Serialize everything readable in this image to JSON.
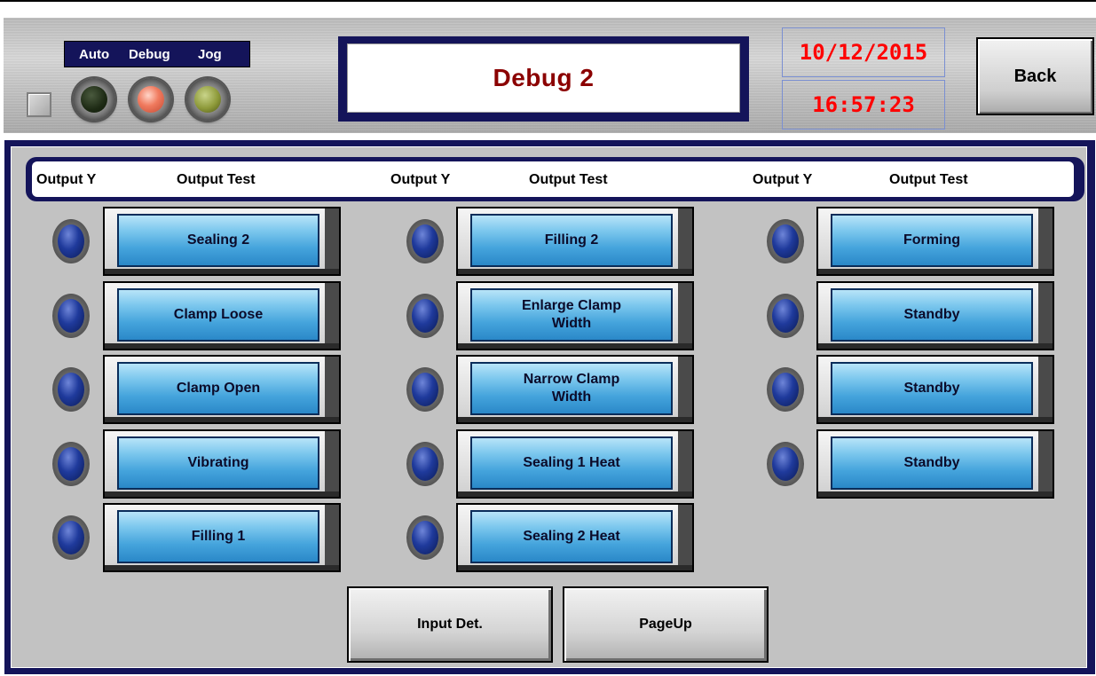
{
  "header": {
    "mode_labels": [
      "Auto",
      "Debug",
      "Jog"
    ],
    "screen_title": "Debug 2",
    "date": "10/12/2015",
    "time": "16:57:23",
    "back_label": "Back"
  },
  "table": {
    "columns": [
      {
        "output_y": "Output Y",
        "output_test": "Output Test"
      },
      {
        "output_y": "Output Y",
        "output_test": "Output Test"
      },
      {
        "output_y": "Output Y",
        "output_test": "Output Test"
      }
    ],
    "col1": [
      "Sealing 2",
      "Clamp Loose",
      "Clamp Open",
      "Vibrating",
      "Filling 1"
    ],
    "col2": [
      "Filling 2",
      "Enlarge Clamp\nWidth",
      "Narrow Clamp\nWidth",
      "Sealing 1 Heat",
      "Sealing 2 Heat"
    ],
    "col3": [
      "Forming",
      "Standby",
      "Standby",
      "Standby"
    ]
  },
  "footer": {
    "input_det_label": "Input Det.",
    "pageup_label": "PageUp"
  },
  "colors": {
    "frame_navy": "#14145a",
    "title_red": "#8b0000",
    "clock_red": "#ff0000",
    "button_blue": "#45a4dc"
  },
  "indicators": {
    "mode_lamps": [
      {
        "name": "auto-lamp",
        "state": "off",
        "color": "dark-green"
      },
      {
        "name": "debug-lamp",
        "state": "on",
        "color": "red"
      },
      {
        "name": "jog-lamp",
        "state": "off",
        "color": "olive"
      }
    ]
  }
}
